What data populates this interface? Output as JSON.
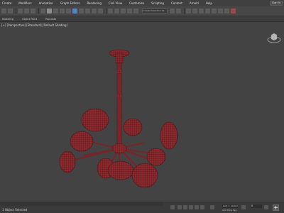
{
  "menu": {
    "items": [
      "Create",
      "Modifiers",
      "Animation",
      "Graph Editors",
      "Rendering",
      "Civil View",
      "Customize",
      "Scripting",
      "Content",
      "Arnold",
      "Help"
    ],
    "sign_in": "Sign In"
  },
  "toolbar": {
    "selection_set": "Create Selection Se",
    "icons": [
      "undo-icon",
      "redo-icon",
      "link-icon",
      "unlink-icon",
      "bind-space-warp-icon",
      "selection-filter-icon",
      "select-object-icon",
      "select-by-name-icon",
      "rectangle-region-icon",
      "window-crossing-icon",
      "move-icon",
      "rotate-icon",
      "scale-icon",
      "reference-coordinate-icon",
      "pivot-icon",
      "snaps-icon",
      "angle-snap-icon",
      "percent-snap-icon",
      "spinner-snap-icon",
      "edit-named-sets-icon",
      "mirror-icon",
      "align-icon",
      "layer-explorer-icon",
      "toggle-ribbon-icon",
      "curve-editor-icon",
      "schematic-view-icon",
      "material-editor-icon",
      "render-setup-icon",
      "rendered-frame-window-icon",
      "render-icon"
    ]
  },
  "ribbon": {
    "tabs": [
      "Modeling",
      "Object Paint",
      "Populate"
    ]
  },
  "viewport": {
    "label": "[+] [Perspective] [Standard] [Default Shading]",
    "object_color": "#8b2a2e",
    "background_color": "#434343"
  },
  "status": {
    "selection": "1 Object Selected",
    "grid": "Grid = 10,0cm",
    "time_tag": "Add Time Tag",
    "frame": "0"
  },
  "colors": {
    "accent": "#5a83b6",
    "mesh": "#8b2a2e"
  }
}
